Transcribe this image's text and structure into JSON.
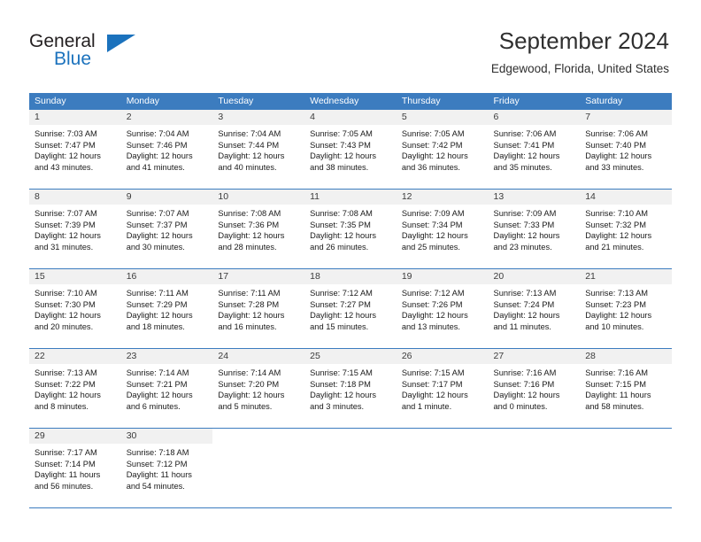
{
  "logo": {
    "word_one": "General",
    "word_two": "Blue",
    "brand_blue": "#1b72bd",
    "brand_dark": "#231f20"
  },
  "header": {
    "title": "September 2024",
    "subtitle": "Edgewood, Florida, United States"
  },
  "theme": {
    "header_row_bg": "#3c7cbf",
    "daynum_band_bg": "#f1f1f1",
    "grid_line": "#3c7cbf"
  },
  "weekdays": [
    "Sunday",
    "Monday",
    "Tuesday",
    "Wednesday",
    "Thursday",
    "Friday",
    "Saturday"
  ],
  "weeks": [
    [
      {
        "day": "1",
        "sunrise": "Sunrise: 7:03 AM",
        "sunset": "Sunset: 7:47 PM",
        "daylight_1": "Daylight: 12 hours",
        "daylight_2": "and 43 minutes."
      },
      {
        "day": "2",
        "sunrise": "Sunrise: 7:04 AM",
        "sunset": "Sunset: 7:46 PM",
        "daylight_1": "Daylight: 12 hours",
        "daylight_2": "and 41 minutes."
      },
      {
        "day": "3",
        "sunrise": "Sunrise: 7:04 AM",
        "sunset": "Sunset: 7:44 PM",
        "daylight_1": "Daylight: 12 hours",
        "daylight_2": "and 40 minutes."
      },
      {
        "day": "4",
        "sunrise": "Sunrise: 7:05 AM",
        "sunset": "Sunset: 7:43 PM",
        "daylight_1": "Daylight: 12 hours",
        "daylight_2": "and 38 minutes."
      },
      {
        "day": "5",
        "sunrise": "Sunrise: 7:05 AM",
        "sunset": "Sunset: 7:42 PM",
        "daylight_1": "Daylight: 12 hours",
        "daylight_2": "and 36 minutes."
      },
      {
        "day": "6",
        "sunrise": "Sunrise: 7:06 AM",
        "sunset": "Sunset: 7:41 PM",
        "daylight_1": "Daylight: 12 hours",
        "daylight_2": "and 35 minutes."
      },
      {
        "day": "7",
        "sunrise": "Sunrise: 7:06 AM",
        "sunset": "Sunset: 7:40 PM",
        "daylight_1": "Daylight: 12 hours",
        "daylight_2": "and 33 minutes."
      }
    ],
    [
      {
        "day": "8",
        "sunrise": "Sunrise: 7:07 AM",
        "sunset": "Sunset: 7:39 PM",
        "daylight_1": "Daylight: 12 hours",
        "daylight_2": "and 31 minutes."
      },
      {
        "day": "9",
        "sunrise": "Sunrise: 7:07 AM",
        "sunset": "Sunset: 7:37 PM",
        "daylight_1": "Daylight: 12 hours",
        "daylight_2": "and 30 minutes."
      },
      {
        "day": "10",
        "sunrise": "Sunrise: 7:08 AM",
        "sunset": "Sunset: 7:36 PM",
        "daylight_1": "Daylight: 12 hours",
        "daylight_2": "and 28 minutes."
      },
      {
        "day": "11",
        "sunrise": "Sunrise: 7:08 AM",
        "sunset": "Sunset: 7:35 PM",
        "daylight_1": "Daylight: 12 hours",
        "daylight_2": "and 26 minutes."
      },
      {
        "day": "12",
        "sunrise": "Sunrise: 7:09 AM",
        "sunset": "Sunset: 7:34 PM",
        "daylight_1": "Daylight: 12 hours",
        "daylight_2": "and 25 minutes."
      },
      {
        "day": "13",
        "sunrise": "Sunrise: 7:09 AM",
        "sunset": "Sunset: 7:33 PM",
        "daylight_1": "Daylight: 12 hours",
        "daylight_2": "and 23 minutes."
      },
      {
        "day": "14",
        "sunrise": "Sunrise: 7:10 AM",
        "sunset": "Sunset: 7:32 PM",
        "daylight_1": "Daylight: 12 hours",
        "daylight_2": "and 21 minutes."
      }
    ],
    [
      {
        "day": "15",
        "sunrise": "Sunrise: 7:10 AM",
        "sunset": "Sunset: 7:30 PM",
        "daylight_1": "Daylight: 12 hours",
        "daylight_2": "and 20 minutes."
      },
      {
        "day": "16",
        "sunrise": "Sunrise: 7:11 AM",
        "sunset": "Sunset: 7:29 PM",
        "daylight_1": "Daylight: 12 hours",
        "daylight_2": "and 18 minutes."
      },
      {
        "day": "17",
        "sunrise": "Sunrise: 7:11 AM",
        "sunset": "Sunset: 7:28 PM",
        "daylight_1": "Daylight: 12 hours",
        "daylight_2": "and 16 minutes."
      },
      {
        "day": "18",
        "sunrise": "Sunrise: 7:12 AM",
        "sunset": "Sunset: 7:27 PM",
        "daylight_1": "Daylight: 12 hours",
        "daylight_2": "and 15 minutes."
      },
      {
        "day": "19",
        "sunrise": "Sunrise: 7:12 AM",
        "sunset": "Sunset: 7:26 PM",
        "daylight_1": "Daylight: 12 hours",
        "daylight_2": "and 13 minutes."
      },
      {
        "day": "20",
        "sunrise": "Sunrise: 7:13 AM",
        "sunset": "Sunset: 7:24 PM",
        "daylight_1": "Daylight: 12 hours",
        "daylight_2": "and 11 minutes."
      },
      {
        "day": "21",
        "sunrise": "Sunrise: 7:13 AM",
        "sunset": "Sunset: 7:23 PM",
        "daylight_1": "Daylight: 12 hours",
        "daylight_2": "and 10 minutes."
      }
    ],
    [
      {
        "day": "22",
        "sunrise": "Sunrise: 7:13 AM",
        "sunset": "Sunset: 7:22 PM",
        "daylight_1": "Daylight: 12 hours",
        "daylight_2": "and 8 minutes."
      },
      {
        "day": "23",
        "sunrise": "Sunrise: 7:14 AM",
        "sunset": "Sunset: 7:21 PM",
        "daylight_1": "Daylight: 12 hours",
        "daylight_2": "and 6 minutes."
      },
      {
        "day": "24",
        "sunrise": "Sunrise: 7:14 AM",
        "sunset": "Sunset: 7:20 PM",
        "daylight_1": "Daylight: 12 hours",
        "daylight_2": "and 5 minutes."
      },
      {
        "day": "25",
        "sunrise": "Sunrise: 7:15 AM",
        "sunset": "Sunset: 7:18 PM",
        "daylight_1": "Daylight: 12 hours",
        "daylight_2": "and 3 minutes."
      },
      {
        "day": "26",
        "sunrise": "Sunrise: 7:15 AM",
        "sunset": "Sunset: 7:17 PM",
        "daylight_1": "Daylight: 12 hours",
        "daylight_2": "and 1 minute."
      },
      {
        "day": "27",
        "sunrise": "Sunrise: 7:16 AM",
        "sunset": "Sunset: 7:16 PM",
        "daylight_1": "Daylight: 12 hours",
        "daylight_2": "and 0 minutes."
      },
      {
        "day": "28",
        "sunrise": "Sunrise: 7:16 AM",
        "sunset": "Sunset: 7:15 PM",
        "daylight_1": "Daylight: 11 hours",
        "daylight_2": "and 58 minutes."
      }
    ],
    [
      {
        "day": "29",
        "sunrise": "Sunrise: 7:17 AM",
        "sunset": "Sunset: 7:14 PM",
        "daylight_1": "Daylight: 11 hours",
        "daylight_2": "and 56 minutes."
      },
      {
        "day": "30",
        "sunrise": "Sunrise: 7:18 AM",
        "sunset": "Sunset: 7:12 PM",
        "daylight_1": "Daylight: 11 hours",
        "daylight_2": "and 54 minutes."
      },
      null,
      null,
      null,
      null,
      null
    ]
  ]
}
